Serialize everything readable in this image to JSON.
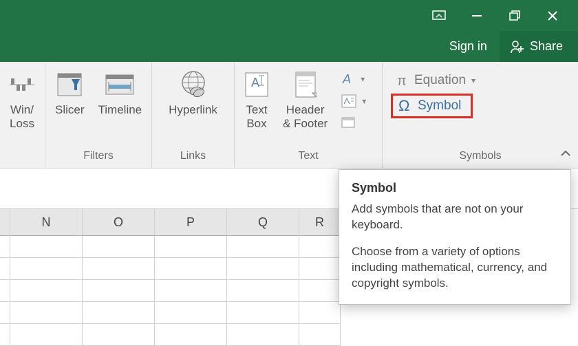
{
  "titlebar": {},
  "account": {
    "signin": "Sign in",
    "share": "Share"
  },
  "ribbon": {
    "groups": {
      "sparklines": {
        "winloss": "Win/\nLoss"
      },
      "filters": {
        "slicer": "Slicer",
        "timeline": "Timeline",
        "label": "Filters"
      },
      "links": {
        "hyperlink": "Hyperlink",
        "label": "Links"
      },
      "text": {
        "textbox": "Text\nBox",
        "header_footer": "Header\n& Footer",
        "label": "Text"
      },
      "symbols": {
        "equation": "Equation",
        "symbol": "Symbol",
        "label": "Symbols"
      }
    }
  },
  "columns": [
    "N",
    "O",
    "P",
    "Q",
    "R"
  ],
  "tooltip": {
    "title": "Symbol",
    "body1": "Add symbols that are not on your keyboard.",
    "body2": "Choose from a variety of options including mathematical, currency, and copyright symbols."
  }
}
